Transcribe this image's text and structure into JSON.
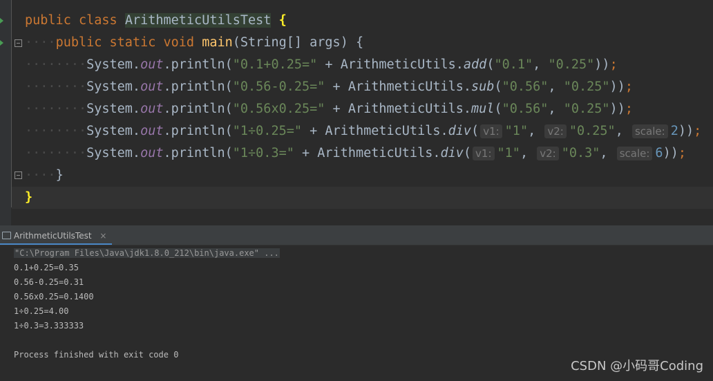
{
  "editor": {
    "lines": {
      "l1": {
        "kw1": "public",
        "kw2": "class",
        "cls": "ArithmeticUtilsTest",
        "brace": "{"
      },
      "l2": {
        "indent": "····",
        "kw1": "public",
        "kw2": "static",
        "kw3": "void",
        "fn": "main",
        "rest": "(String[] args) {"
      },
      "l3": {
        "indent": "········",
        "sys": "System.",
        "out": "out",
        "print": ".println(",
        "str1": "\"0.1+0.25=\"",
        "plus": " + ArithmeticUtils.",
        "method": "add",
        "open": "(",
        "a1": "\"0.1\"",
        "comma": ", ",
        "a2": "\"0.25\"",
        "close": "))",
        "semi": ";"
      },
      "l4": {
        "indent": "········",
        "sys": "System.",
        "out": "out",
        "print": ".println(",
        "str1": "\"0.56-0.25=\"",
        "plus": " + ArithmeticUtils.",
        "method": "sub",
        "open": "(",
        "a1": "\"0.56\"",
        "comma": ", ",
        "a2": "\"0.25\"",
        "close": "))",
        "semi": ";"
      },
      "l5": {
        "indent": "········",
        "sys": "System.",
        "out": "out",
        "print": ".println(",
        "str1": "\"0.56x0.25=\"",
        "plus": " + ArithmeticUtils.",
        "method": "mul",
        "open": "(",
        "a1": "\"0.56\"",
        "comma": ", ",
        "a2": "\"0.25\"",
        "close": "))",
        "semi": ";"
      },
      "l6": {
        "indent": "········",
        "sys": "System.",
        "out": "out",
        "print": ".println(",
        "str1": "\"1÷0.25=\"",
        "plus": " + ArithmeticUtils.",
        "method": "div",
        "open": "(",
        "h1": "v1:",
        "a1": "\"1\"",
        "comma1": ", ",
        "h2": "v2:",
        "a2": "\"0.25\"",
        "comma2": ", ",
        "h3": "scale:",
        "a3": "2",
        "close": "))",
        "semi": ";"
      },
      "l7": {
        "indent": "········",
        "sys": "System.",
        "out": "out",
        "print": ".println(",
        "str1": "\"1÷0.3=\"",
        "plus": " + ArithmeticUtils.",
        "method": "div",
        "open": "(",
        "h1": "v1:",
        "a1": "\"1\"",
        "comma1": ", ",
        "h2": "v2:",
        "a2": "\"0.3\"",
        "comma2": ", ",
        "h3": "scale:",
        "a3": "6",
        "close": "))",
        "semi": ";"
      },
      "l8": {
        "indent": "····",
        "brace": "}"
      },
      "l9": {
        "brace": "}"
      }
    }
  },
  "run_panel": {
    "tab_label": "ArithmeticUtilsTest",
    "tab_close": "×",
    "command": "\"C:\\Program Files\\Java\\jdk1.8.0_212\\bin\\java.exe\" ...",
    "output": [
      "0.1+0.25=0.35",
      "0.56-0.25=0.31",
      "0.56x0.25=0.1400",
      "1÷0.25=4.00",
      "1÷0.3=3.333333"
    ],
    "exit_message": "Process finished with exit code 0"
  },
  "watermark": "CSDN @小码哥Coding",
  "colors": {
    "keyword": "#cc7832",
    "string": "#6a8759",
    "number": "#6897bb",
    "method_decl": "#ffc66d",
    "static_field": "#9876aa",
    "background": "#2b2b2b"
  }
}
